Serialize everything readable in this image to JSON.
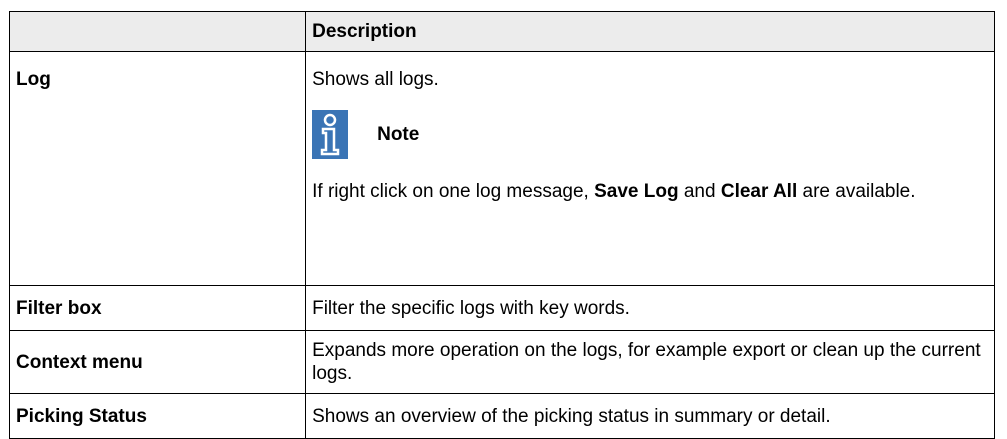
{
  "table": {
    "header": {
      "col1": "",
      "col2": "Description"
    },
    "rows": [
      {
        "term": "Log",
        "description": "Shows all logs.",
        "note": {
          "label": "Note",
          "text_before": "If right click on one log message, ",
          "bold1": "Save Log",
          "text_mid": " and ",
          "bold2": "Clear All",
          "text_after": " are available."
        }
      },
      {
        "term": "Filter box",
        "description": "Filter the specific logs with key words."
      },
      {
        "term": "Context menu",
        "description": "Expands more operation on the logs, for example export or clean up the current logs."
      },
      {
        "term": "Picking Status",
        "description": "Shows an overview of the picking status in summary or detail."
      }
    ]
  },
  "colors": {
    "header_bg": "#ececec",
    "note_icon_bg": "#3a74b5",
    "border": "#000000"
  },
  "icons": {
    "note": "info-note-icon"
  }
}
